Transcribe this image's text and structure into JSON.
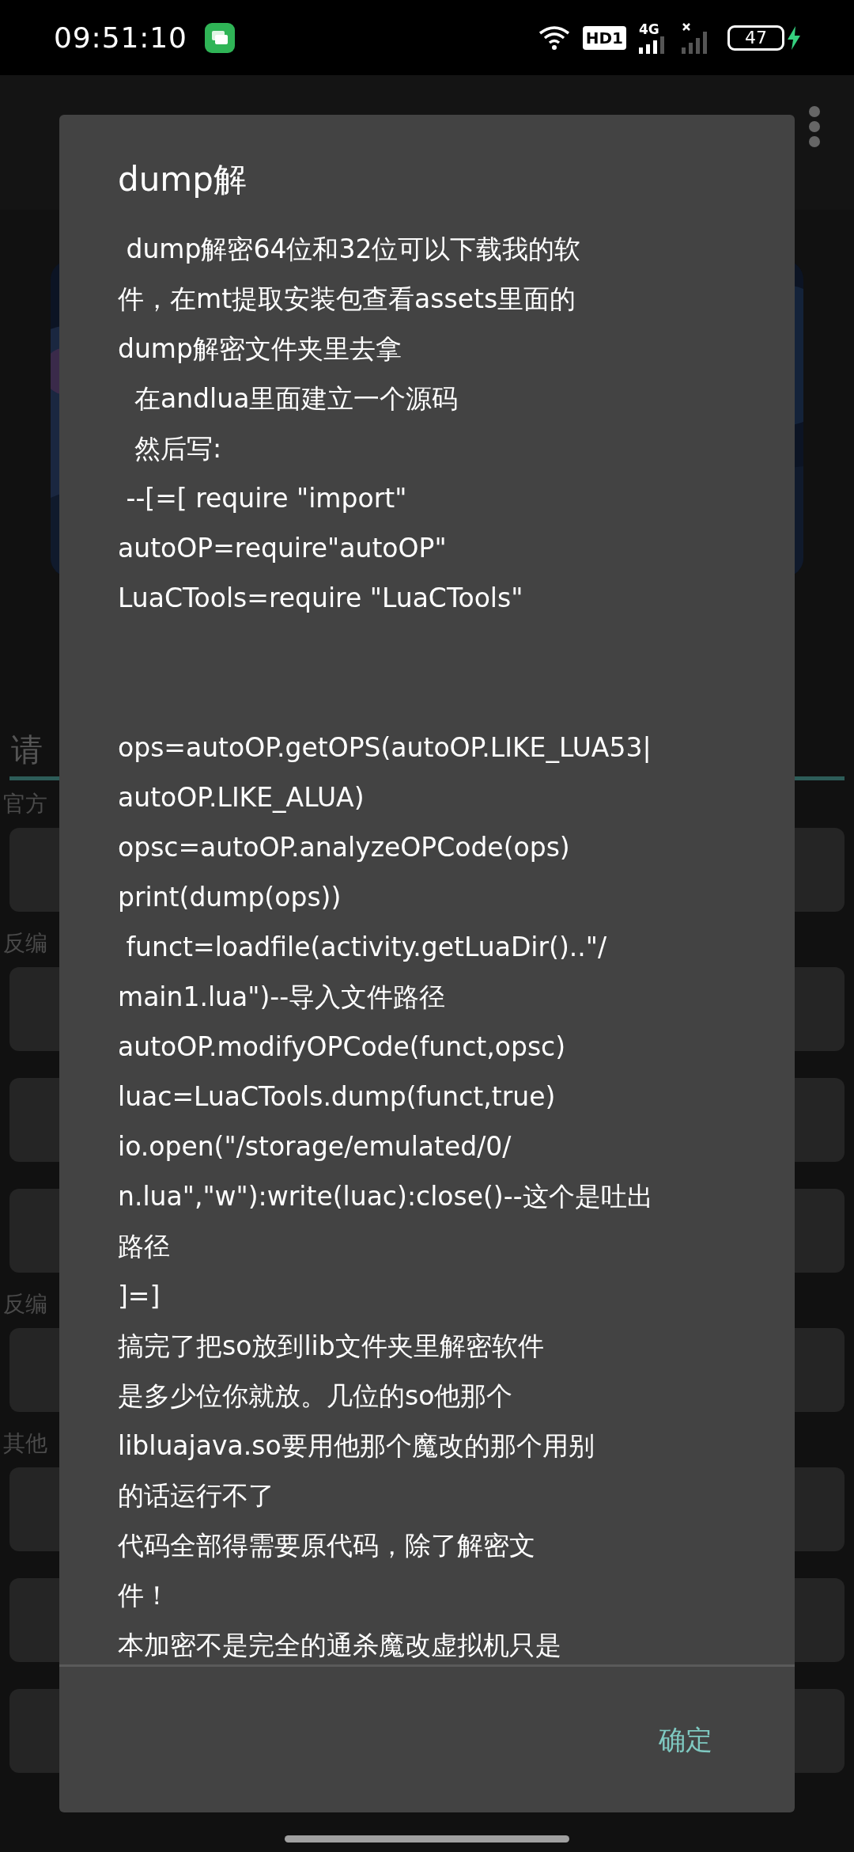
{
  "status_bar": {
    "time": "09:51:10",
    "hd_badge": "HD1",
    "network": "4G",
    "battery": "47"
  },
  "background": {
    "tab_label": "请",
    "sections": [
      {
        "label": "官方"
      },
      {
        "label": "反编"
      },
      {
        "label": "反编"
      },
      {
        "label": "其他"
      }
    ]
  },
  "dialog": {
    "title": "dump解",
    "body_blocks": [
      {
        "lines": [
          " dump解密64位和32位可以下载我的软",
          "件，在mt提取安装包查看assets里面的",
          "dump解密文件夹里去拿",
          "  在andlua里面建立一个源码",
          "  然后写:",
          " --[=[ require \"import\"",
          "autoOP=require\"autoOP\"",
          "LuaCTools=require \"LuaCTools\""
        ]
      },
      {
        "lines": [
          "ops=autoOP.getOPS(autoOP.LIKE_LUA53|",
          "autoOP.LIKE_ALUA)",
          "opsc=autoOP.analyzeOPCode(ops)",
          "print(dump(ops))",
          " funct=loadfile(activity.getLuaDir()..\"/",
          "main1.lua\")--导入文件路径",
          "autoOP.modifyOPCode(funct,opsc)",
          "luac=LuaCTools.dump(funct,true)",
          "io.open(\"/storage/emulated/0/",
          "n.lua\",\"w\"):write(luac):close()--这个是吐出",
          "路径",
          "]=]",
          "搞完了把so放到lib文件夹里解密软件",
          "是多少位你就放。几位的so他那个",
          "libluajava.so要用他那个魔改的那个用别",
          "的话运行不了",
          "代码全部得需要原代码，除了解密文",
          "件！",
          "本加密不是完全的通杀魔改虚拟机只是"
        ]
      }
    ],
    "button": "确定"
  }
}
